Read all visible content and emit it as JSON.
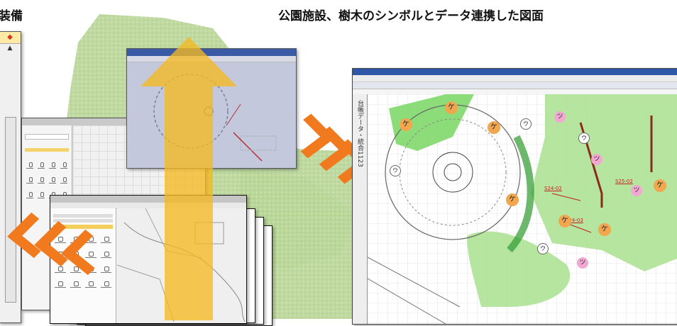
{
  "headings": {
    "left": "装備",
    "right": "公園施設、樹木のシンボルとデータ連携した図面"
  },
  "colors": {
    "map_green": "#b9d79a",
    "arrow_yellow": "#f5b921",
    "chevron_orange": "#f07a1d",
    "plan_green": "#9fdc84",
    "marker_orange": "#f2a64e",
    "marker_pink": "#f1a9d2",
    "title_bar_blue": "#2f57a8"
  },
  "icons": {
    "up_arrow": "up-arrow-icon",
    "forward_chevrons": "chevron-right-icon",
    "back_chevrons": "chevron-left-icon"
  },
  "cad_window": {
    "side_panel_label": "台帳データ・統合1123",
    "tree_markers": [
      "ケ",
      "ケ",
      "ケ",
      "ケ",
      "ケ",
      "ケ",
      "ケ",
      "ツ",
      "ツ",
      "ツ",
      "ツ",
      "ウ",
      "ウ",
      "ウ",
      "ウ"
    ],
    "annotations": [
      "S24-02",
      "S24-03",
      "S25-02"
    ]
  }
}
